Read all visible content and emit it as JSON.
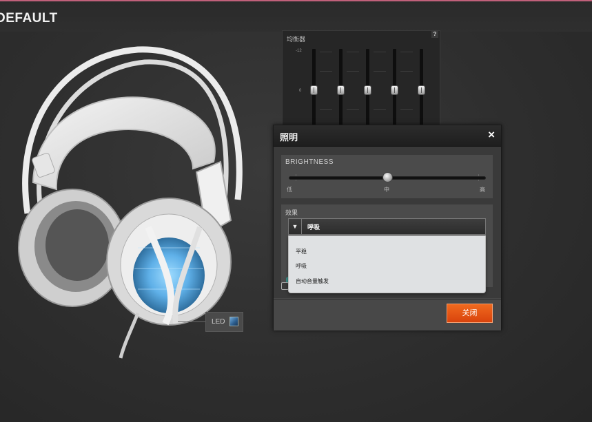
{
  "header": {
    "profile_name": "DEFAULT"
  },
  "equalizer": {
    "title": "均衡器",
    "help": "?",
    "top_label": "-12",
    "mid_label": "0",
    "bands": [
      {
        "level": 0.5
      },
      {
        "level": 0.5
      },
      {
        "level": 0.5
      },
      {
        "level": 0.5
      },
      {
        "level": 0.5
      }
    ]
  },
  "led": {
    "label": "LED",
    "color": "#3f7fb8"
  },
  "lighting_dialog": {
    "title": "照明",
    "close_icon": "×",
    "brightness": {
      "label": "BRIGHTNESS",
      "value": 0.5,
      "stops": [
        "低",
        "中",
        "高"
      ]
    },
    "effect": {
      "label": "效果",
      "selected": "呼吸",
      "options": [
        "平稳",
        "呼吸",
        "自动音量触发"
      ]
    },
    "close_button_label": "关闭"
  },
  "colors": {
    "accent": "#e8561a",
    "led_blue": "#6fb6ea"
  }
}
